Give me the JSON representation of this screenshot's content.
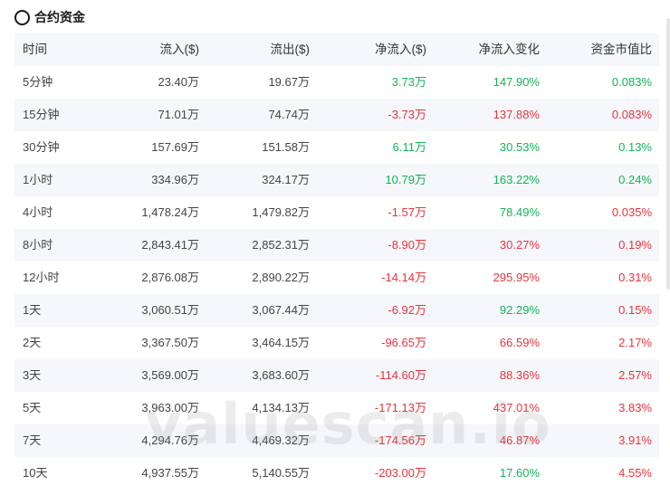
{
  "title": "合约资金",
  "columns": [
    "时间",
    "流入($)",
    "流出($)",
    "净流入($)",
    "净流入变化",
    "资金市值比"
  ],
  "rows": [
    {
      "period": "5分钟",
      "inflow": "23.40万",
      "outflow": "19.67万",
      "net": "3.73万",
      "net_sign": "pos",
      "change": "147.90%",
      "change_sign": "pos",
      "ratio": "0.083%",
      "ratio_sign": "pos"
    },
    {
      "period": "15分钟",
      "inflow": "71.01万",
      "outflow": "74.74万",
      "net": "-3.73万",
      "net_sign": "neg",
      "change": "137.88%",
      "change_sign": "neg",
      "ratio": "0.083%",
      "ratio_sign": "neg"
    },
    {
      "period": "30分钟",
      "inflow": "157.69万",
      "outflow": "151.58万",
      "net": "6.11万",
      "net_sign": "pos",
      "change": "30.53%",
      "change_sign": "pos",
      "ratio": "0.13%",
      "ratio_sign": "pos"
    },
    {
      "period": "1小时",
      "inflow": "334.96万",
      "outflow": "324.17万",
      "net": "10.79万",
      "net_sign": "pos",
      "change": "163.22%",
      "change_sign": "pos",
      "ratio": "0.24%",
      "ratio_sign": "pos"
    },
    {
      "period": "4小时",
      "inflow": "1,478.24万",
      "outflow": "1,479.82万",
      "net": "-1.57万",
      "net_sign": "neg",
      "change": "78.49%",
      "change_sign": "pos",
      "ratio": "0.035%",
      "ratio_sign": "neg"
    },
    {
      "period": "8小时",
      "inflow": "2,843.41万",
      "outflow": "2,852.31万",
      "net": "-8.90万",
      "net_sign": "neg",
      "change": "30.27%",
      "change_sign": "neg",
      "ratio": "0.19%",
      "ratio_sign": "neg"
    },
    {
      "period": "12小时",
      "inflow": "2,876.08万",
      "outflow": "2,890.22万",
      "net": "-14.14万",
      "net_sign": "neg",
      "change": "295.95%",
      "change_sign": "neg",
      "ratio": "0.31%",
      "ratio_sign": "neg"
    },
    {
      "period": "1天",
      "inflow": "3,060.51万",
      "outflow": "3,067.44万",
      "net": "-6.92万",
      "net_sign": "neg",
      "change": "92.29%",
      "change_sign": "pos",
      "ratio": "0.15%",
      "ratio_sign": "neg"
    },
    {
      "period": "2天",
      "inflow": "3,367.50万",
      "outflow": "3,464.15万",
      "net": "-96.65万",
      "net_sign": "neg",
      "change": "66.59%",
      "change_sign": "neg",
      "ratio": "2.17%",
      "ratio_sign": "neg"
    },
    {
      "period": "3天",
      "inflow": "3,569.00万",
      "outflow": "3,683.60万",
      "net": "-114.60万",
      "net_sign": "neg",
      "change": "88.36%",
      "change_sign": "neg",
      "ratio": "2.57%",
      "ratio_sign": "neg"
    },
    {
      "period": "5天",
      "inflow": "3,963.00万",
      "outflow": "4,134.13万",
      "net": "-171.13万",
      "net_sign": "neg",
      "change": "437.01%",
      "change_sign": "neg",
      "ratio": "3.83%",
      "ratio_sign": "neg"
    },
    {
      "period": "7天",
      "inflow": "4,294.76万",
      "outflow": "4,469.32万",
      "net": "-174.56万",
      "net_sign": "neg",
      "change": "46.87%",
      "change_sign": "neg",
      "ratio": "3.91%",
      "ratio_sign": "neg"
    },
    {
      "period": "10天",
      "inflow": "4,937.55万",
      "outflow": "5,140.55万",
      "net": "-203.00万",
      "net_sign": "neg",
      "change": "17.60%",
      "change_sign": "pos",
      "ratio": "4.55%",
      "ratio_sign": "neg"
    }
  ],
  "watermark": "valuescan.io",
  "colors": {
    "positive": "#13b25a",
    "negative": "#e8343c",
    "row_alt": "#f5f7fa"
  },
  "icons": {
    "logo": "circle-swirl-icon"
  }
}
